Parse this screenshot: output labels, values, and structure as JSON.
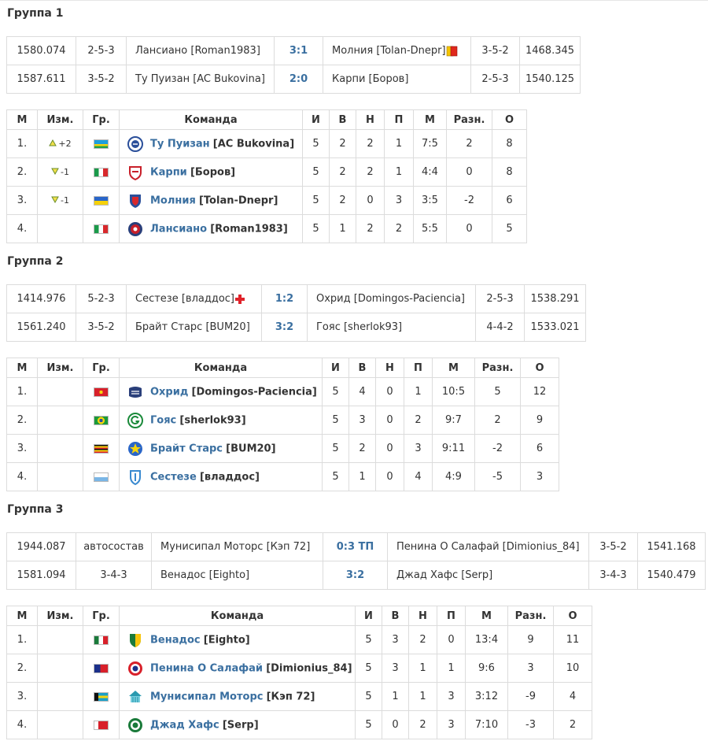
{
  "groups": [
    {
      "title": "Группа 1",
      "matches": [
        {
          "r1": "1580.074",
          "f1": "2-5-3",
          "t1": "Лансиано [Roman1983]",
          "score": "3:1",
          "t2": "Молния [Tolan-Dnepr]",
          "t2_icon": "yellow-red-card-icon",
          "f2": "3-5-2",
          "r2": "1468.345"
        },
        {
          "r1": "1587.611",
          "f1": "3-5-2",
          "t1": "Ту Пуизан [AC Bukovina]",
          "score": "2:0",
          "t2": "Карпи [Боров]",
          "f2": "2-5-3",
          "r2": "1540.125"
        }
      ],
      "headers": [
        "М",
        "Изм.",
        "Гр.",
        "Команда",
        "И",
        "В",
        "Н",
        "П",
        "М",
        "Разн.",
        "О"
      ],
      "rows": [
        {
          "pos": "1.",
          "chg": "+2",
          "dir": "up",
          "flag": "rwanda-flag",
          "logo": "blue-crest-logo",
          "club": "Ту Пуизан",
          "mgr": "[AC Bukovina]",
          "p": "5",
          "w": "2",
          "d": "2",
          "l": "1",
          "g": "7:5",
          "diff": "2",
          "pts": "8"
        },
        {
          "pos": "2.",
          "chg": "-1",
          "dir": "down",
          "flag": "italy-flag",
          "logo": "red-shield-logo",
          "club": "Карпи",
          "mgr": "[Боров]",
          "p": "5",
          "w": "2",
          "d": "2",
          "l": "1",
          "g": "4:4",
          "diff": "0",
          "pts": "8"
        },
        {
          "pos": "3.",
          "chg": "-1",
          "dir": "down",
          "flag": "ukraine-flag",
          "logo": "blue-red-shield-logo",
          "club": "Молния",
          "mgr": "[Tolan-Dnepr]",
          "p": "5",
          "w": "2",
          "d": "0",
          "l": "3",
          "g": "3:5",
          "diff": "-2",
          "pts": "6"
        },
        {
          "pos": "4.",
          "chg": "",
          "dir": "",
          "flag": "italy-flag",
          "logo": "red-round-crest-logo",
          "club": "Лансиано",
          "mgr": "[Roman1983]",
          "p": "5",
          "w": "1",
          "d": "2",
          "l": "2",
          "g": "5:5",
          "diff": "0",
          "pts": "5"
        }
      ]
    },
    {
      "title": "Группа 2",
      "matches": [
        {
          "r1": "1414.976",
          "f1": "5-2-3",
          "t1": "Сестезе [владдос]",
          "t1_icon": "red-cross-icon",
          "score": "1:2",
          "t2": "Охрид [Domingos-Paciencia]",
          "f2": "2-5-3",
          "r2": "1538.291"
        },
        {
          "r1": "1561.240",
          "f1": "3-5-2",
          "t1": "Брайт Старс [BUM20]",
          "score": "3:2",
          "t2": "Гояс [sherlok93]",
          "f2": "4-4-2",
          "r2": "1533.021"
        }
      ],
      "headers": [
        "М",
        "Изм.",
        "Гр.",
        "Команда",
        "И",
        "В",
        "Н",
        "П",
        "М",
        "Разн.",
        "О"
      ],
      "rows": [
        {
          "pos": "1.",
          "chg": "",
          "dir": "",
          "flag": "macedonia-flag",
          "logo": "navy-crest-logo",
          "club": "Охрид",
          "mgr": "[Domingos-Paciencia]",
          "p": "5",
          "w": "4",
          "d": "0",
          "l": "1",
          "g": "10:5",
          "diff": "5",
          "pts": "12"
        },
        {
          "pos": "2.",
          "chg": "",
          "dir": "",
          "flag": "brazil-flag",
          "logo": "green-g-logo",
          "club": "Гояс",
          "mgr": "[sherlok93]",
          "p": "5",
          "w": "3",
          "d": "0",
          "l": "2",
          "g": "9:7",
          "diff": "2",
          "pts": "9"
        },
        {
          "pos": "3.",
          "chg": "",
          "dir": "",
          "flag": "uganda-flag",
          "logo": "blue-yellow-logo",
          "club": "Брайт Старс",
          "mgr": "[BUM20]",
          "p": "5",
          "w": "2",
          "d": "0",
          "l": "3",
          "g": "9:11",
          "diff": "-2",
          "pts": "6"
        },
        {
          "pos": "4.",
          "chg": "",
          "dir": "",
          "flag": "san-marino-flag",
          "logo": "light-blue-shield-logo",
          "club": "Сестезе",
          "mgr": "[владдос]",
          "p": "5",
          "w": "1",
          "d": "0",
          "l": "4",
          "g": "4:9",
          "diff": "-5",
          "pts": "3"
        }
      ]
    },
    {
      "title": "Группа 3",
      "matches": [
        {
          "r1": "1944.087",
          "f1": "автосостав",
          "t1": "Мунисипал Моторс [Кэп 72]",
          "score": "0:3 ТП",
          "t2": "Пенина О Салафай [Dimionius_84]",
          "f2": "3-5-2",
          "r2": "1541.168"
        },
        {
          "r1": "1581.094",
          "f1": "3-4-3",
          "t1": "Венадос [Eighto]",
          "score": "3:2",
          "t2": "Джад Хафс [Serp]",
          "f2": "3-4-3",
          "r2": "1540.479"
        }
      ],
      "headers": [
        "М",
        "Изм.",
        "Гр.",
        "Команда",
        "И",
        "В",
        "Н",
        "П",
        "М",
        "Разн.",
        "О"
      ],
      "rows": [
        {
          "pos": "1.",
          "chg": "",
          "dir": "",
          "flag": "mexico-flag",
          "logo": "green-yellow-shield-logo",
          "club": "Венадос",
          "mgr": "[Eighto]",
          "p": "5",
          "w": "3",
          "d": "2",
          "l": "0",
          "g": "13:4",
          "diff": "9",
          "pts": "11"
        },
        {
          "pos": "2.",
          "chg": "",
          "dir": "",
          "flag": "samoa-flag",
          "logo": "red-navy-badge-logo",
          "club": "Пенина О Салафай",
          "mgr": "[Dimionius_84]",
          "p": "5",
          "w": "3",
          "d": "1",
          "l": "1",
          "g": "9:6",
          "diff": "3",
          "pts": "10"
        },
        {
          "pos": "3.",
          "chg": "",
          "dir": "",
          "flag": "bahamas-flag",
          "logo": "teal-building-logo",
          "club": "Мунисипал Моторс",
          "mgr": "[Кэп 72]",
          "p": "5",
          "w": "1",
          "d": "1",
          "l": "3",
          "g": "3:12",
          "diff": "-9",
          "pts": "4"
        },
        {
          "pos": "4.",
          "chg": "",
          "dir": "",
          "flag": "bahrain-flag",
          "logo": "green-round-logo",
          "club": "Джад Хафс",
          "mgr": "[Serp]",
          "p": "5",
          "w": "0",
          "d": "2",
          "l": "3",
          "g": "7:10",
          "diff": "-3",
          "pts": "2"
        }
      ]
    }
  ]
}
